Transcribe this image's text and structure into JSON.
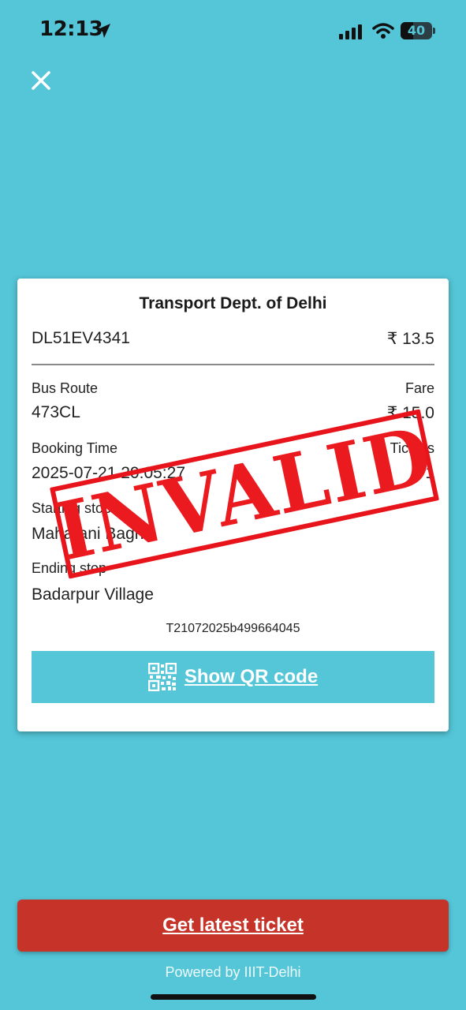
{
  "status_bar": {
    "time": "12:13",
    "battery_level": 40,
    "battery_text": "40",
    "icons": [
      "location-arrow-icon",
      "cellular-signal-icon",
      "wifi-icon",
      "battery-icon"
    ]
  },
  "header": {
    "close_icon": "close-icon"
  },
  "ticket": {
    "organization": "Transport Dept. of Delhi",
    "vehicle_number": "DL51EV4341",
    "amount": "₹ 13.5",
    "bus_route_label": "Bus Route",
    "bus_route_value": "473CL",
    "fare_label": "Fare",
    "fare_value": "₹ 15.0",
    "booking_time_label": "Booking Time",
    "booking_time_value": "2025-07-21 20:05:27",
    "tickets_label": "Tickets",
    "tickets_value": "1",
    "starting_stop_label": "Starting stop",
    "starting_stop_value": "Maharani Bagh",
    "ending_stop_label": "Ending stop",
    "ending_stop_value": "Badarpur Village",
    "ticket_id": "T21072025b499664045",
    "qr_button_label": "Show QR code",
    "stamp_text": "INVALID"
  },
  "footer": {
    "latest_button_label": "Get latest ticket",
    "powered_by": "Powered by IIIT-Delhi"
  },
  "colors": {
    "background": "#54c6d8",
    "stamp": "#ea1a1f",
    "latest_button": "#c63328"
  }
}
